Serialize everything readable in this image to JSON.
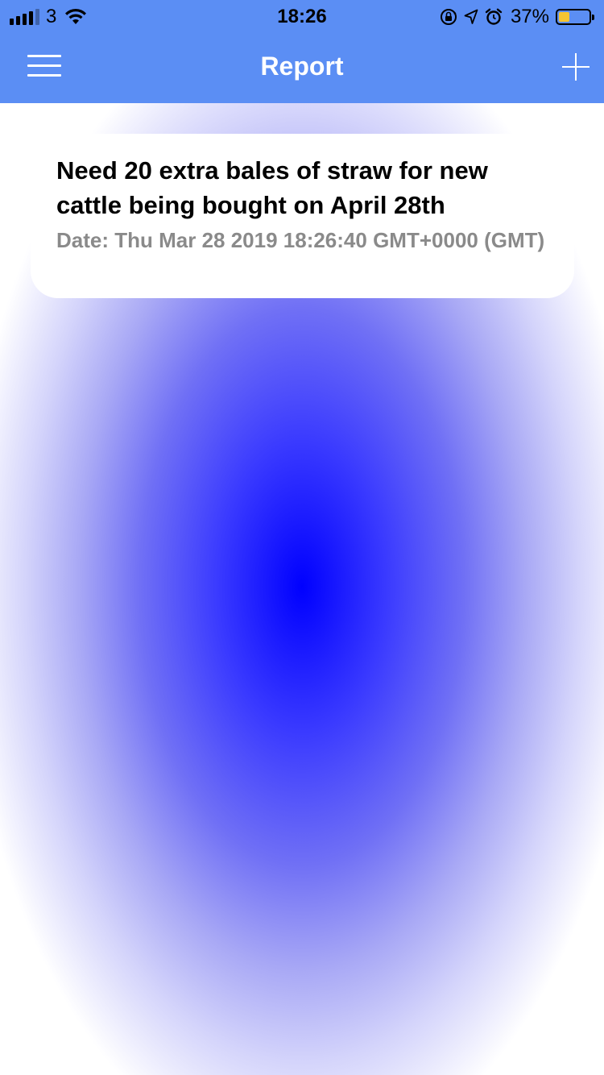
{
  "status_bar": {
    "carrier": "3",
    "time": "18:26",
    "battery_percent": "37%",
    "battery_level": 0.37,
    "icons": [
      "signal-icon",
      "wifi-icon",
      "orientation-lock-icon",
      "location-icon",
      "alarm-icon",
      "battery-icon"
    ]
  },
  "nav": {
    "title": "Report",
    "menu_icon": "hamburger-menu-icon",
    "add_icon": "plus-icon"
  },
  "reports": [
    {
      "title": "Need 20 extra bales of straw for new cattle being bought on April 28th",
      "date": "Date: Thu Mar 28 2019 18:26:40 GMT+0000 (GMT)"
    }
  ],
  "colors": {
    "header": "#5b8ef4",
    "background_center": "#0000ff",
    "background_edge": "#ffffff",
    "card": "#ffffff",
    "date_text": "#8a8a8a",
    "battery_fill": "#f5c431"
  }
}
